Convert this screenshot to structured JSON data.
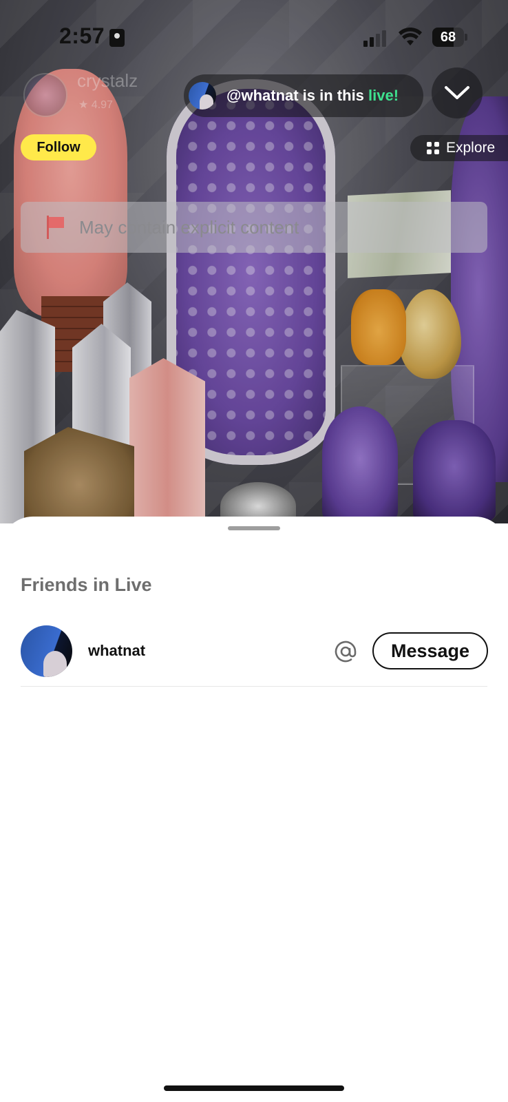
{
  "status_bar": {
    "time": "2:57",
    "battery_percent": 68,
    "battery_label": "68",
    "signal_bars_active": 2,
    "signal_bars_total": 4
  },
  "stream": {
    "seller_name": "crystalz",
    "seller_rating": "4.97",
    "friend_pill": {
      "prefix": "@whatnat is in this ",
      "highlight": "live!",
      "highlight_color": "#3ee08e"
    },
    "follow_label": "Follow",
    "follow_color": "#ffe94a",
    "explore_label": "Explore",
    "explicit_notice": "May contain explicit content"
  },
  "sheet": {
    "title": "Friends in Live",
    "friends": [
      {
        "name": "whatnat",
        "action_label": "Message"
      }
    ]
  },
  "icons": {
    "collapse": "chevron-down-icon",
    "explore": "grid-icon",
    "explicit": "flag-icon",
    "mention": "at-sign-icon"
  }
}
